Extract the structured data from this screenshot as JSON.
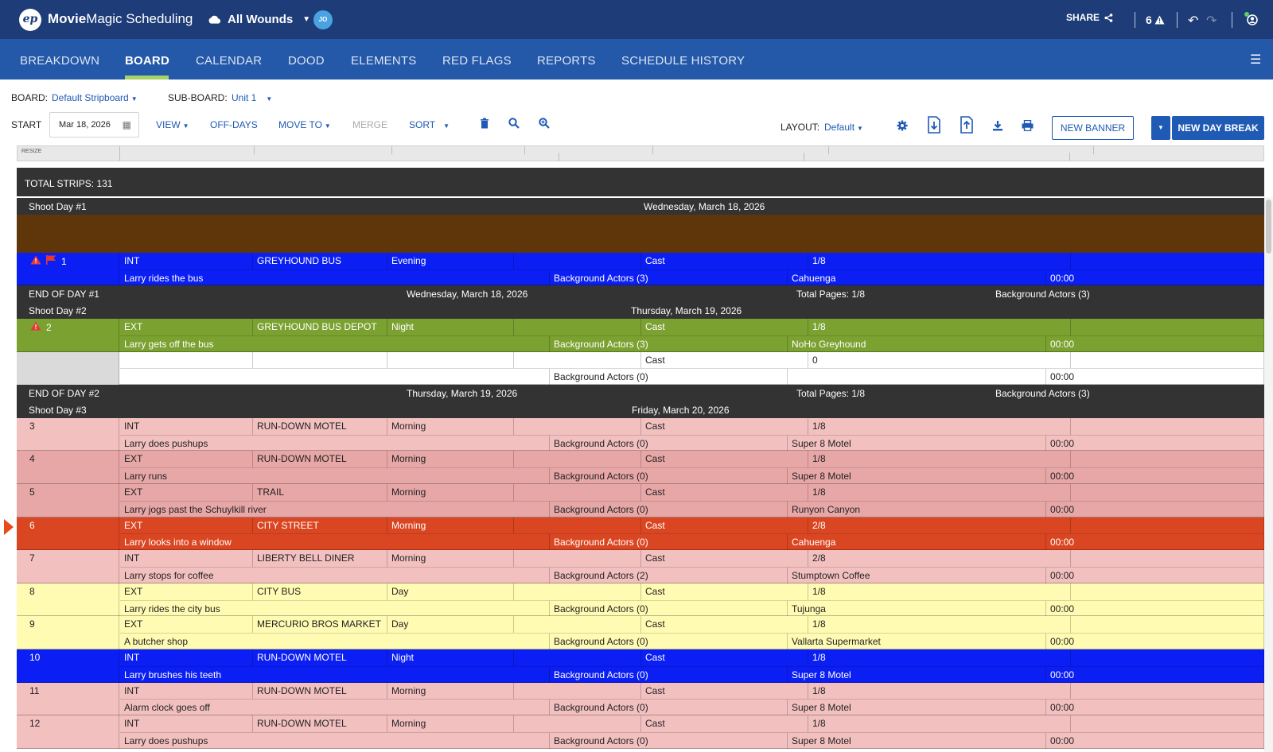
{
  "app": {
    "logo_text": "ep",
    "name_bold": "Movie",
    "name_rest": "Magic Scheduling"
  },
  "project": {
    "name": "All Wounds",
    "user_initials": "JO"
  },
  "header_actions": {
    "share_label": "SHARE",
    "warning_count": "6"
  },
  "colors": {
    "header_bg": "#1d3c78",
    "nav_bg": "#2458a8",
    "accent": "#1f5ab4",
    "active_tab_underline": "#a6d268",
    "warn": "#e53935"
  },
  "nav": {
    "tabs": [
      {
        "label": "BREAKDOWN"
      },
      {
        "label": "BOARD"
      },
      {
        "label": "CALENDAR"
      },
      {
        "label": "DOOD"
      },
      {
        "label": "ELEMENTS"
      },
      {
        "label": "RED FLAGS"
      },
      {
        "label": "REPORTS"
      },
      {
        "label": "SCHEDULE HISTORY"
      }
    ],
    "active": "BOARD"
  },
  "controls": {
    "board_label": "BOARD:",
    "board_value": "Default Stripboard",
    "subboard_label": "SUB-BOARD:",
    "subboard_value": "Unit 1",
    "start_label": "START",
    "start_date": "Mar 18, 2026",
    "view": "VIEW",
    "off_days": "OFF-DAYS",
    "move_to": "MOVE TO",
    "merge": "MERGE",
    "sort": "SORT",
    "layout_label": "LAYOUT:",
    "layout_value": "Default",
    "new_banner": "NEW BANNER",
    "new_day_break": "NEW DAY BREAK"
  },
  "board": {
    "resize_label": "RESIZE",
    "total_strips": "TOTAL STRIPS: 131",
    "day1_header": {
      "left": "Shoot Day #1",
      "date": "Wednesday, March 18, 2026"
    },
    "day1_end": {
      "left": "END OF DAY #1",
      "date": "Wednesday, March 18, 2026",
      "pages": "Total Pages: 1/8",
      "bg": "Background Actors (3)"
    },
    "day2_header": {
      "left": "Shoot Day #2",
      "date": "Thursday, March 19, 2026"
    },
    "day2_end": {
      "left": "END OF DAY #2",
      "date": "Thursday, March 19, 2026",
      "pages": "Total Pages: 1/8",
      "bg": "Background Actors (3)"
    },
    "day3_header": {
      "left": "Shoot Day #3",
      "date": "Friday, March 20, 2026"
    },
    "strips": [
      {
        "num": "1",
        "ie": "INT",
        "set": "GREYHOUND BUS",
        "time": "Evening",
        "cast": "Cast",
        "pages": "1/8",
        "desc": "Larry rides the bus",
        "bg": "Background Actors (3)",
        "loc": "Cahuenga",
        "dur": "00:00"
      },
      {
        "num": "2",
        "ie": "EXT",
        "set": "GREYHOUND BUS DEPOT",
        "time": "Night",
        "cast": "Cast",
        "pages": "1/8",
        "desc": "Larry gets off the bus",
        "bg": "Background Actors (3)",
        "loc": "NoHo Greyhound",
        "dur": "00:00"
      },
      {
        "num": "",
        "ie": "",
        "set": "",
        "time": "",
        "cast": "Cast",
        "pages": "0",
        "desc": "",
        "bg": "Background Actors (0)",
        "loc": "",
        "dur": "00:00"
      },
      {
        "num": "3",
        "ie": "INT",
        "set": "RUN-DOWN MOTEL",
        "time": "Morning",
        "cast": "Cast",
        "pages": "1/8",
        "desc": "Larry does pushups",
        "bg": "Background Actors (0)",
        "loc": "Super 8 Motel",
        "dur": "00:00"
      },
      {
        "num": "4",
        "ie": "EXT",
        "set": "RUN-DOWN MOTEL",
        "time": "Morning",
        "cast": "Cast",
        "pages": "1/8",
        "desc": "Larry runs",
        "bg": "Background Actors (0)",
        "loc": "Super 8 Motel",
        "dur": "00:00"
      },
      {
        "num": "5",
        "ie": "EXT",
        "set": "TRAIL",
        "time": "Morning",
        "cast": "Cast",
        "pages": "1/8",
        "desc": "Larry jogs past the Schuylkill river",
        "bg": "Background Actors (0)",
        "loc": "Runyon Canyon",
        "dur": "00:00"
      },
      {
        "num": "6",
        "ie": "EXT",
        "set": "CITY STREET",
        "time": "Morning",
        "cast": "Cast",
        "pages": "2/8",
        "desc": "Larry looks into a window",
        "bg": "Background Actors (0)",
        "loc": "Cahuenga",
        "dur": "00:00"
      },
      {
        "num": "7",
        "ie": "INT",
        "set": "LIBERTY BELL DINER",
        "time": "Morning",
        "cast": "Cast",
        "pages": "2/8",
        "desc": "Larry stops for coffee",
        "bg": "Background Actors (2)",
        "loc": "Stumptown Coffee",
        "dur": "00:00"
      },
      {
        "num": "8",
        "ie": "EXT",
        "set": "CITY BUS",
        "time": "Day",
        "cast": "Cast",
        "pages": "1/8",
        "desc": "Larry rides the city bus",
        "bg": "Background Actors (0)",
        "loc": "Tujunga",
        "dur": "00:00"
      },
      {
        "num": "9",
        "ie": "EXT",
        "set": "MERCURIO BROS MARKET",
        "time": "Day",
        "cast": "Cast",
        "pages": "1/8",
        "desc": "A butcher shop",
        "bg": "Background Actors (0)",
        "loc": "Vallarta Supermarket",
        "dur": "00:00"
      },
      {
        "num": "10",
        "ie": "INT",
        "set": "RUN-DOWN MOTEL",
        "time": "Night",
        "cast": "Cast",
        "pages": "1/8",
        "desc": "Larry brushes his teeth",
        "bg": "Background Actors (0)",
        "loc": "Super 8 Motel",
        "dur": "00:00"
      },
      {
        "num": "11",
        "ie": "INT",
        "set": "RUN-DOWN MOTEL",
        "time": "Morning",
        "cast": "Cast",
        "pages": "1/8",
        "desc": "Alarm clock goes off",
        "bg": "Background Actors (0)",
        "loc": "Super 8 Motel",
        "dur": "00:00"
      },
      {
        "num": "12",
        "ie": "INT",
        "set": "RUN-DOWN MOTEL",
        "time": "Morning",
        "cast": "Cast",
        "pages": "1/8",
        "desc": "Larry does pushups",
        "bg": "Background Actors (0)",
        "loc": "Super 8 Motel",
        "dur": "00:00"
      }
    ]
  }
}
